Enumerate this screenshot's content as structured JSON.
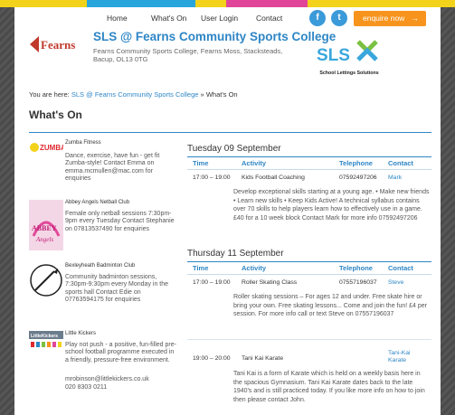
{
  "nav": {
    "items": [
      "Home",
      "What's On",
      "User Login",
      "Contact"
    ],
    "social": [
      "f",
      "t"
    ],
    "enquire_label": "enquire now"
  },
  "header": {
    "logo_text": "Fearns",
    "title": "SLS @ Fearns Community Sports College",
    "subtitle": "Fearns Community Sports College, Fearns Moss, Stacksteads, Bacup, OL13 0TG",
    "partner_logo_text": "SLS",
    "partner_tagline": "School Lettings Solutions"
  },
  "breadcrumb": {
    "prefix": "You are here:",
    "link": "SLS @ Fearns Community Sports College",
    "separator": "»",
    "current": "What's On"
  },
  "page_title": "What's On",
  "clubs": [
    {
      "name": "Zumba Fitness",
      "logo_text": "ZUMBA",
      "description": "Dance, exercise, have fun - get fit Zumba-style! Contact Emma on emma.mcmullen@mac.com for enquiries"
    },
    {
      "name": "Abbey Angels Netball Club",
      "logo_text": "ABBEY Angels",
      "description": "Female only netball sessions 7:30pm-9pm every Tuesday Contact Stephanie on 07813537490 for enquiries"
    },
    {
      "name": "Bexleyheath Badminton Club",
      "logo_text": "",
      "description": "Community badminton sessions, 7:30pm-9:30pm every Monday in the sports hall Contact Edie on 07763594175 for enquiries"
    },
    {
      "name": "Little Kickers",
      "logo_text": "LittleKickers",
      "description": "Play not push - a positive, fun-filled pre-school football programme executed in a friendly, pressure-free environment.",
      "email": "mrobinson@littlekickers.co.uk",
      "phone": "020 8303 0211"
    }
  ],
  "columns": {
    "time": "Time",
    "activity": "Activity",
    "telephone": "Telephone",
    "contact": "Contact"
  },
  "days": [
    {
      "date": "Tuesday 09 September",
      "events": [
        {
          "time": "17:00 – 19:00",
          "activity": "Kids Football Coaching",
          "telephone": "07592497206",
          "contact": "Mark",
          "details": "Develop exceptional skills starting at a young age. • Make new friends • Learn new skills • Keep Kids Active! A technical syllabus contains over 70 skills to help players learn how to effectively use in a game. £40 for a 10 week block Contact Mark for more info 07592497206"
        }
      ]
    },
    {
      "date": "Thursday 11 September",
      "events": [
        {
          "time": "17:00 – 19:00",
          "activity": "Roller Skating Class",
          "telephone": "07557196037",
          "contact": "Steve",
          "details": "Roller skating sessions – For ages 12 and under. Free skate hire or bring your own. Free skating lessons... Come and join the fun! £4 per session. For more info call or text Steve on 07557196037"
        },
        {
          "time": "19:00 – 20:00",
          "activity": "Tani Kai Karate",
          "telephone": "",
          "contact": "Tani-Kai Karate",
          "details": "Tani Kai is a form of Karate which is held on a weekly basis here in the spacious Gymnasium. Tani Kai Karate dates back to the late 1940's and is still practiced today. If you like more info on how to join then please contact John."
        }
      ]
    }
  ]
}
